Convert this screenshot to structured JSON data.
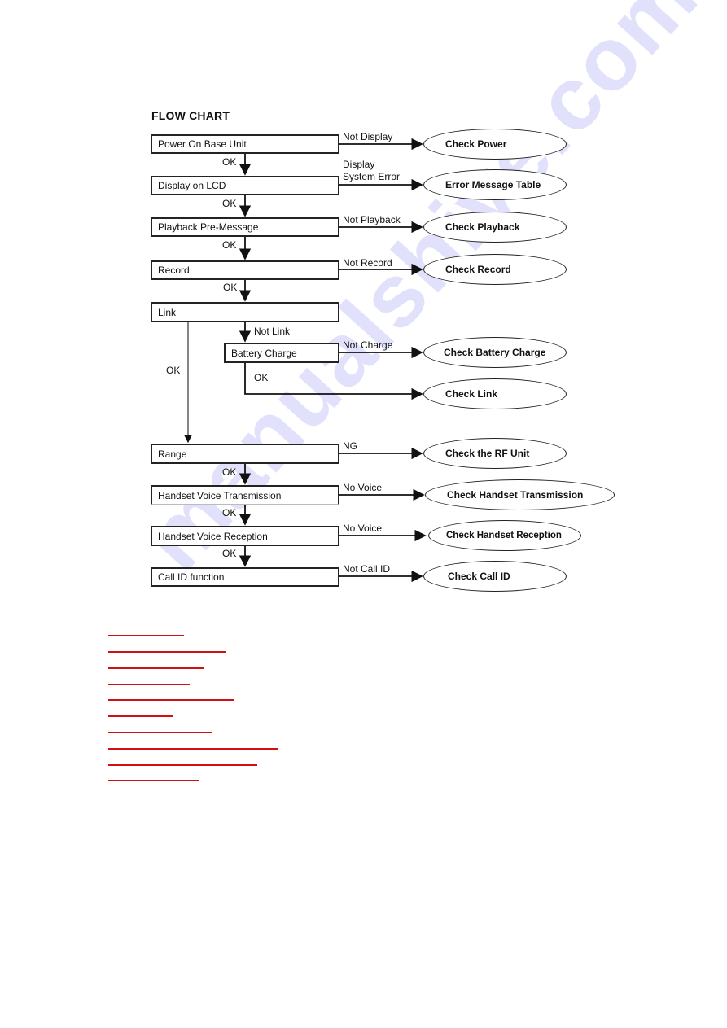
{
  "title": "FLOW CHART",
  "watermark": "manualshive.com",
  "steps": [
    {
      "label": "Power On Base Unit",
      "fail": "Not Display",
      "fail2": "",
      "result": "Check Power",
      "ok": "OK"
    },
    {
      "label": "Display on LCD",
      "fail": "Display",
      "fail2": "System Error",
      "result": "Error Message Table",
      "ok": "OK"
    },
    {
      "label": "Playback Pre-Message",
      "fail": "Not Playback",
      "fail2": "",
      "result": "Check Playback",
      "ok": "OK"
    },
    {
      "label": "Record",
      "fail": "Not Record",
      "fail2": "",
      "result": "Check Record",
      "ok": "OK"
    },
    {
      "label": "Link",
      "fail": "Not Link",
      "fail2": "",
      "result": "",
      "ok": "OK"
    },
    {
      "label": "Battery Charge",
      "fail": "Not Charge",
      "fail2": "",
      "result": "Check Battery Charge",
      "ok": "OK"
    },
    {
      "label": "",
      "fail": "",
      "fail2": "",
      "result": "Check Link",
      "ok": ""
    },
    {
      "label": "Range",
      "fail": "NG",
      "fail2": "",
      "result": "Check the RF Unit",
      "ok": "OK"
    },
    {
      "label": "Handset Voice Transmission",
      "fail": "No Voice",
      "fail2": "",
      "result": "Check Handset Transmission",
      "ok": "OK"
    },
    {
      "label": "Handset Voice Reception",
      "fail": "No Voice",
      "fail2": "",
      "result": "Check Handset Reception",
      "ok": "OK"
    },
    {
      "label": "Call ID function",
      "fail": "Not Call ID",
      "fail2": "",
      "result": "Check Call ID",
      "ok": ""
    }
  ],
  "link_colors": {
    "link": "#d01010"
  },
  "links_count": 10
}
